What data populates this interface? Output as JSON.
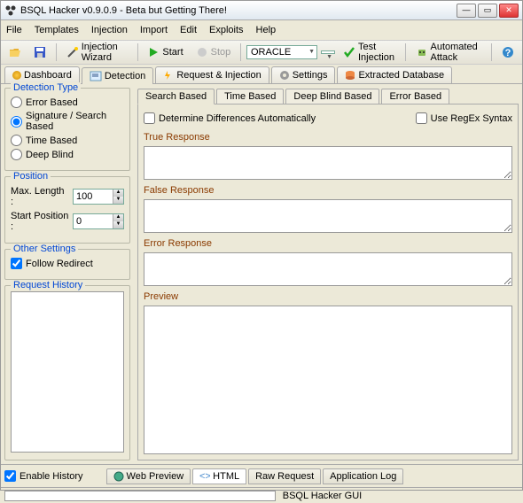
{
  "window": {
    "title": "BSQL Hacker v0.9.0.9 - Beta but Getting There!"
  },
  "menu": {
    "file": "File",
    "templates": "Templates",
    "injection": "Injection",
    "import": "Import",
    "edit": "Edit",
    "exploits": "Exploits",
    "help": "Help"
  },
  "toolbar": {
    "wizard": "Injection Wizard",
    "start": "Start",
    "stop": "Stop",
    "db": "ORACLE",
    "test": "Test Injection",
    "auto": "Automated Attack"
  },
  "maintabs": {
    "dashboard": "Dashboard",
    "detection": "Detection",
    "reqinj": "Request & Injection",
    "settings": "Settings",
    "extracted": "Extracted Database"
  },
  "detection": {
    "type_title": "Detection Type",
    "error": "Error Based",
    "sig": "Signature / Search Based",
    "time": "Time Based",
    "deep": "Deep Blind",
    "pos_title": "Position",
    "maxlen_label": "Max. Length :",
    "maxlen_val": "100",
    "startpos_label": "Start Position :",
    "startpos_val": "0",
    "other_title": "Other Settings",
    "follow": "Follow Redirect",
    "reqhist_title": "Request History",
    "enable_hist": "Enable History"
  },
  "righttabs": {
    "search": "Search Based",
    "time": "Time Based",
    "deep": "Deep Blind Based",
    "error": "Error Based"
  },
  "search": {
    "auto": "Determine Differences Automatically",
    "regex": "Use RegEx Syntax",
    "true_label": "True Response",
    "false_label": "False Response",
    "error_label": "Error Response",
    "preview_label": "Preview"
  },
  "bottomtabs": {
    "web": "Web Preview",
    "html": "HTML",
    "raw": "Raw Request",
    "app": "Application Log"
  },
  "status": {
    "text": "BSQL Hacker GUI"
  }
}
